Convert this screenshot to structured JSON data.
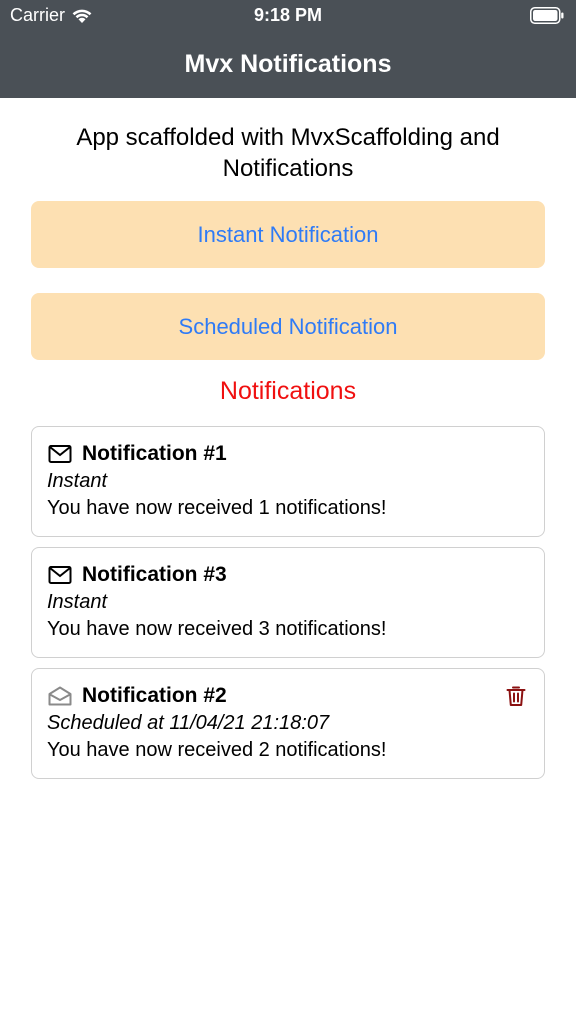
{
  "status_bar": {
    "carrier": "Carrier",
    "time": "9:18 PM"
  },
  "nav": {
    "title": "Mvx Notifications"
  },
  "intro": "App scaffolded with MvxScaffolding and Notifications",
  "buttons": {
    "instant_label": "Instant Notification",
    "scheduled_label": "Scheduled Notification"
  },
  "section_title": "Notifications",
  "notifications": [
    {
      "title": "Notification #1",
      "kind": "Instant",
      "message": "You have now received 1 notifications!",
      "icon": "envelope-icon",
      "deletable": false
    },
    {
      "title": "Notification #3",
      "kind": "Instant",
      "message": "You have now received 3 notifications!",
      "icon": "envelope-icon",
      "deletable": false
    },
    {
      "title": "Notification #2",
      "kind": "Scheduled at 11/04/21 21:18:07",
      "message": "You have now received 2 notifications!",
      "icon": "envelope-open-icon",
      "deletable": true
    }
  ],
  "colors": {
    "nav_bg": "#4a5056",
    "button_bg": "#fde0b2",
    "button_text": "#2f7bf6",
    "section_title": "#f01010",
    "trash": "#8b1111"
  }
}
